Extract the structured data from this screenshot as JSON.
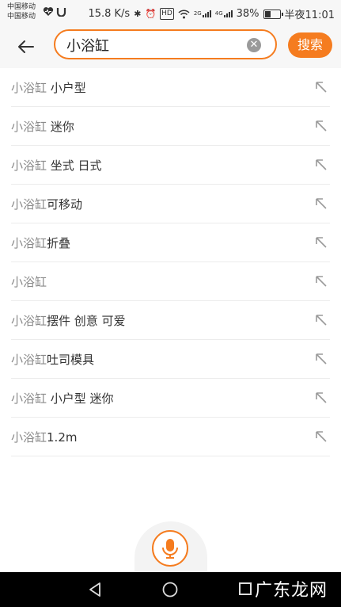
{
  "status_bar": {
    "carrier_1": "中国移动",
    "carrier_2": "中国移动",
    "speed": "15.8 K/s",
    "network_1": "2G",
    "network_2": "4G",
    "battery": "38%",
    "battery_level": 0.38,
    "time": "半夜11:01"
  },
  "search": {
    "query": "小浴缸",
    "button_label": "搜索"
  },
  "suggestions": [
    {
      "keyword": "小浴缸",
      "rest": " 小户型"
    },
    {
      "keyword": "小浴缸",
      "rest": " 迷你"
    },
    {
      "keyword": "小浴缸",
      "rest": " 坐式 日式"
    },
    {
      "keyword": "小浴缸",
      "rest": "可移动"
    },
    {
      "keyword": "小浴缸",
      "rest": "折叠"
    },
    {
      "keyword": "小浴缸",
      "rest": ""
    },
    {
      "keyword": "小浴缸",
      "rest": "摆件 创意 可爱"
    },
    {
      "keyword": "小浴缸",
      "rest": "吐司模具"
    },
    {
      "keyword": "小浴缸",
      "rest": " 小户型 迷你"
    },
    {
      "keyword": "小浴缸",
      "rest": "1.2m"
    }
  ],
  "watermark": "广东龙网",
  "colors": {
    "accent": "#f57c1f",
    "keyword_text": "#8a8a8a",
    "text": "#333333"
  },
  "icons": {
    "back": "back-arrow-icon",
    "clear": "clear-icon",
    "fill": "fill-arrow-icon",
    "mic": "microphone-icon"
  }
}
